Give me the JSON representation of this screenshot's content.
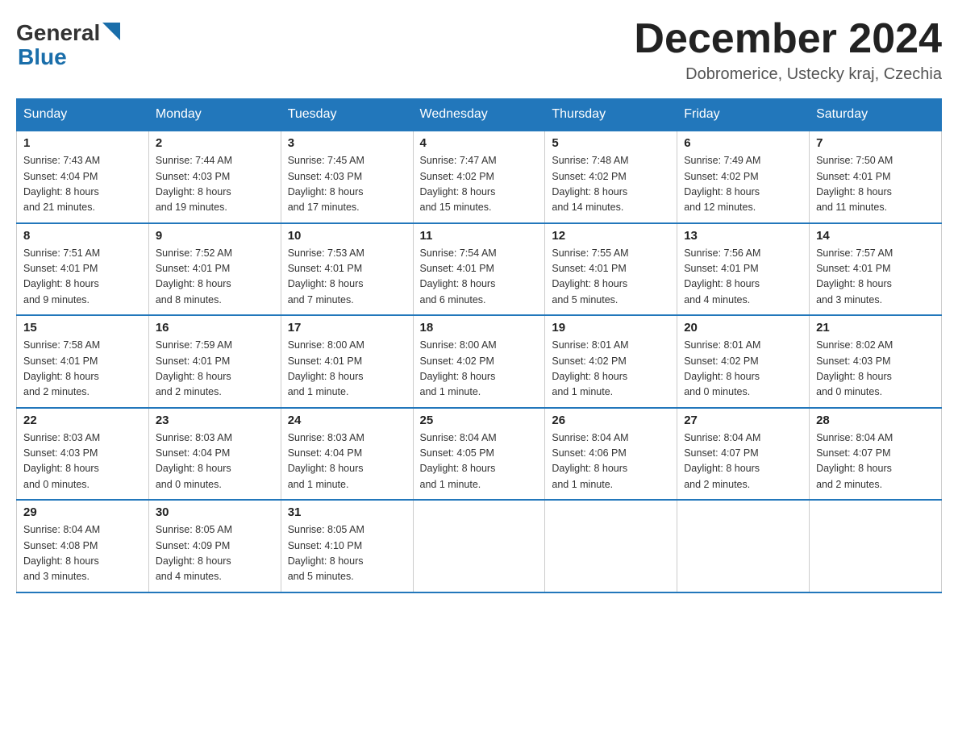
{
  "header": {
    "logo_general": "General",
    "logo_blue": "Blue",
    "title": "December 2024",
    "location": "Dobromerice, Ustecky kraj, Czechia"
  },
  "days_of_week": [
    "Sunday",
    "Monday",
    "Tuesday",
    "Wednesday",
    "Thursday",
    "Friday",
    "Saturday"
  ],
  "weeks": [
    [
      {
        "day": "1",
        "sunrise": "7:43 AM",
        "sunset": "4:04 PM",
        "daylight": "8 hours and 21 minutes."
      },
      {
        "day": "2",
        "sunrise": "7:44 AM",
        "sunset": "4:03 PM",
        "daylight": "8 hours and 19 minutes."
      },
      {
        "day": "3",
        "sunrise": "7:45 AM",
        "sunset": "4:03 PM",
        "daylight": "8 hours and 17 minutes."
      },
      {
        "day": "4",
        "sunrise": "7:47 AM",
        "sunset": "4:02 PM",
        "daylight": "8 hours and 15 minutes."
      },
      {
        "day": "5",
        "sunrise": "7:48 AM",
        "sunset": "4:02 PM",
        "daylight": "8 hours and 14 minutes."
      },
      {
        "day": "6",
        "sunrise": "7:49 AM",
        "sunset": "4:02 PM",
        "daylight": "8 hours and 12 minutes."
      },
      {
        "day": "7",
        "sunrise": "7:50 AM",
        "sunset": "4:01 PM",
        "daylight": "8 hours and 11 minutes."
      }
    ],
    [
      {
        "day": "8",
        "sunrise": "7:51 AM",
        "sunset": "4:01 PM",
        "daylight": "8 hours and 9 minutes."
      },
      {
        "day": "9",
        "sunrise": "7:52 AM",
        "sunset": "4:01 PM",
        "daylight": "8 hours and 8 minutes."
      },
      {
        "day": "10",
        "sunrise": "7:53 AM",
        "sunset": "4:01 PM",
        "daylight": "8 hours and 7 minutes."
      },
      {
        "day": "11",
        "sunrise": "7:54 AM",
        "sunset": "4:01 PM",
        "daylight": "8 hours and 6 minutes."
      },
      {
        "day": "12",
        "sunrise": "7:55 AM",
        "sunset": "4:01 PM",
        "daylight": "8 hours and 5 minutes."
      },
      {
        "day": "13",
        "sunrise": "7:56 AM",
        "sunset": "4:01 PM",
        "daylight": "8 hours and 4 minutes."
      },
      {
        "day": "14",
        "sunrise": "7:57 AM",
        "sunset": "4:01 PM",
        "daylight": "8 hours and 3 minutes."
      }
    ],
    [
      {
        "day": "15",
        "sunrise": "7:58 AM",
        "sunset": "4:01 PM",
        "daylight": "8 hours and 2 minutes."
      },
      {
        "day": "16",
        "sunrise": "7:59 AM",
        "sunset": "4:01 PM",
        "daylight": "8 hours and 2 minutes."
      },
      {
        "day": "17",
        "sunrise": "8:00 AM",
        "sunset": "4:01 PM",
        "daylight": "8 hours and 1 minute."
      },
      {
        "day": "18",
        "sunrise": "8:00 AM",
        "sunset": "4:02 PM",
        "daylight": "8 hours and 1 minute."
      },
      {
        "day": "19",
        "sunrise": "8:01 AM",
        "sunset": "4:02 PM",
        "daylight": "8 hours and 1 minute."
      },
      {
        "day": "20",
        "sunrise": "8:01 AM",
        "sunset": "4:02 PM",
        "daylight": "8 hours and 0 minutes."
      },
      {
        "day": "21",
        "sunrise": "8:02 AM",
        "sunset": "4:03 PM",
        "daylight": "8 hours and 0 minutes."
      }
    ],
    [
      {
        "day": "22",
        "sunrise": "8:03 AM",
        "sunset": "4:03 PM",
        "daylight": "8 hours and 0 minutes."
      },
      {
        "day": "23",
        "sunrise": "8:03 AM",
        "sunset": "4:04 PM",
        "daylight": "8 hours and 0 minutes."
      },
      {
        "day": "24",
        "sunrise": "8:03 AM",
        "sunset": "4:04 PM",
        "daylight": "8 hours and 1 minute."
      },
      {
        "day": "25",
        "sunrise": "8:04 AM",
        "sunset": "4:05 PM",
        "daylight": "8 hours and 1 minute."
      },
      {
        "day": "26",
        "sunrise": "8:04 AM",
        "sunset": "4:06 PM",
        "daylight": "8 hours and 1 minute."
      },
      {
        "day": "27",
        "sunrise": "8:04 AM",
        "sunset": "4:07 PM",
        "daylight": "8 hours and 2 minutes."
      },
      {
        "day": "28",
        "sunrise": "8:04 AM",
        "sunset": "4:07 PM",
        "daylight": "8 hours and 2 minutes."
      }
    ],
    [
      {
        "day": "29",
        "sunrise": "8:04 AM",
        "sunset": "4:08 PM",
        "daylight": "8 hours and 3 minutes."
      },
      {
        "day": "30",
        "sunrise": "8:05 AM",
        "sunset": "4:09 PM",
        "daylight": "8 hours and 4 minutes."
      },
      {
        "day": "31",
        "sunrise": "8:05 AM",
        "sunset": "4:10 PM",
        "daylight": "8 hours and 5 minutes."
      },
      null,
      null,
      null,
      null
    ]
  ]
}
